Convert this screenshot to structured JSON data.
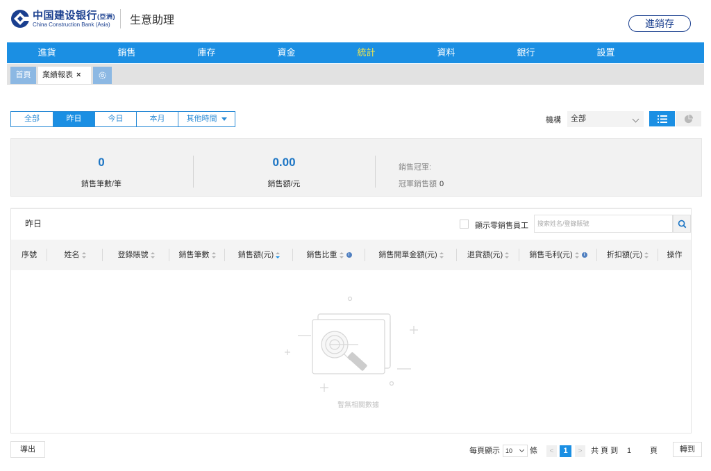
{
  "header": {
    "logo_cn": "中国建设银行",
    "logo_cn_suffix": "(亞洲)",
    "logo_en": "China Construction Bank (Asia)",
    "app_title": "生意助理",
    "jxc_button": "進銷存"
  },
  "mainnav": {
    "items": [
      {
        "label": "進貨"
      },
      {
        "label": "銷售"
      },
      {
        "label": "庫存"
      },
      {
        "label": "資金"
      },
      {
        "label": "統計"
      },
      {
        "label": "資料"
      },
      {
        "label": "銀行"
      },
      {
        "label": "設置"
      }
    ],
    "active_index": 4
  },
  "tabs": {
    "home": "首頁",
    "active": "業績報表",
    "close": "×"
  },
  "filters": {
    "buttons": [
      "全部",
      "昨日",
      "今日",
      "本月",
      "其他時間"
    ],
    "active_index": 1,
    "org_label": "機構",
    "org_value": "全部"
  },
  "summary": {
    "count_value": "0",
    "count_label": "銷售筆數/筆",
    "amount_value": "0.00",
    "amount_label": "銷售額/元",
    "champion_label": "銷售冠軍:",
    "champion_value": "",
    "champion_amount_label": "冠軍銷售額",
    "champion_amount_value": "0"
  },
  "table": {
    "title": "昨日",
    "show_zero_label": "顯示零銷售員工",
    "search_placeholder": "搜索姓名/登錄賬號",
    "columns": [
      {
        "label": "序號"
      },
      {
        "label": "姓名"
      },
      {
        "label": "登錄賬號"
      },
      {
        "label": "銷售筆數"
      },
      {
        "label": "銷售額(元)"
      },
      {
        "label": "銷售比重"
      },
      {
        "label": "銷售開單金額(元)"
      },
      {
        "label": "退貨額(元)"
      },
      {
        "label": "銷售毛利(元)"
      },
      {
        "label": "折扣額(元)"
      },
      {
        "label": "操作"
      }
    ],
    "rows": [],
    "empty_text": "暫無相關數據"
  },
  "footer": {
    "export_label": "導出",
    "per_page_label": "每頁顯示",
    "per_page_value": "10",
    "per_page_unit": "條",
    "prev": "<",
    "current_page": "1",
    "next": ">",
    "total_label": "共 頁 到",
    "goto_value": "1",
    "page_label": "頁",
    "jump_label": "轉到"
  },
  "colors": {
    "nav_blue": "#1b8fe3",
    "nav_active": "#f5e74b",
    "brand_navy": "#1a3f8f",
    "value_blue": "#1c75c4"
  }
}
